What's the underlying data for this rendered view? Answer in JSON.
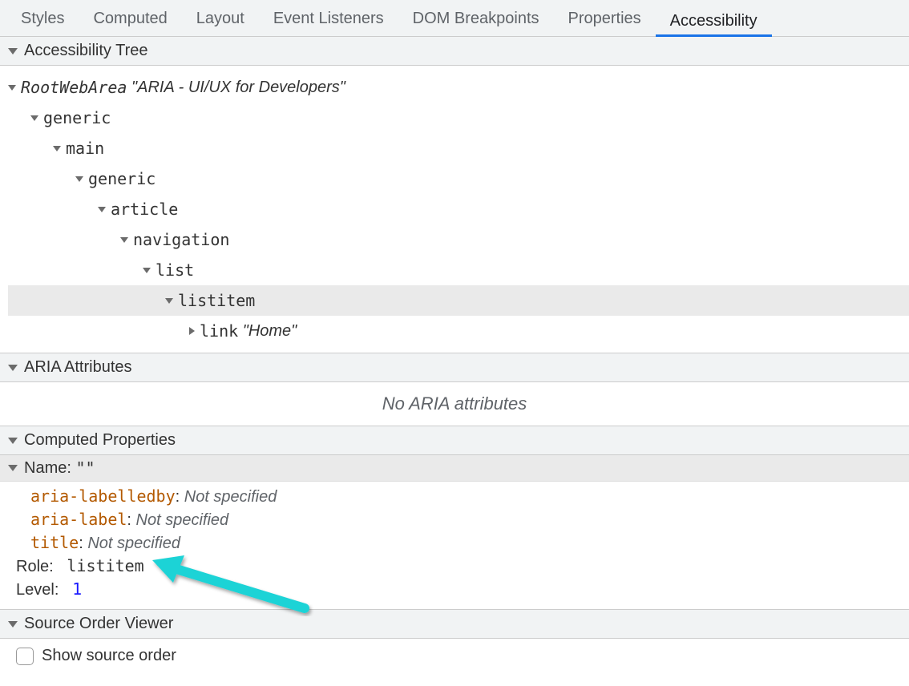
{
  "tabs": {
    "styles": "Styles",
    "computed": "Computed",
    "layout": "Layout",
    "eventListeners": "Event Listeners",
    "domBreakpoints": "DOM Breakpoints",
    "properties": "Properties",
    "accessibility": "Accessibility"
  },
  "sections": {
    "tree": "Accessibility Tree",
    "aria": "ARIA Attributes",
    "computed": "Computed Properties",
    "source": "Source Order Viewer"
  },
  "tree": {
    "root": {
      "role": "RootWebArea",
      "name": "\"ARIA - UI/UX for Developers\""
    },
    "n1": "generic",
    "n2": "main",
    "n3": "generic",
    "n4": "article",
    "n5": "navigation",
    "n6": "list",
    "n7": "listitem",
    "link": {
      "role": "link",
      "name": "\"Home\""
    }
  },
  "ariaAttributes": {
    "empty": "No ARIA attributes"
  },
  "computedProps": {
    "nameLabel": "Name:",
    "nameValue": "\"\"",
    "labelledby": {
      "attr": "aria-labelledby",
      "status": "Not specified"
    },
    "arialabel": {
      "attr": "aria-label",
      "status": "Not specified"
    },
    "title": {
      "attr": "title",
      "status": "Not specified"
    },
    "roleLabel": "Role:",
    "roleValue": "listitem",
    "levelLabel": "Level:",
    "levelValue": "1"
  },
  "sourceOrder": {
    "checkboxLabel": "Show source order"
  }
}
